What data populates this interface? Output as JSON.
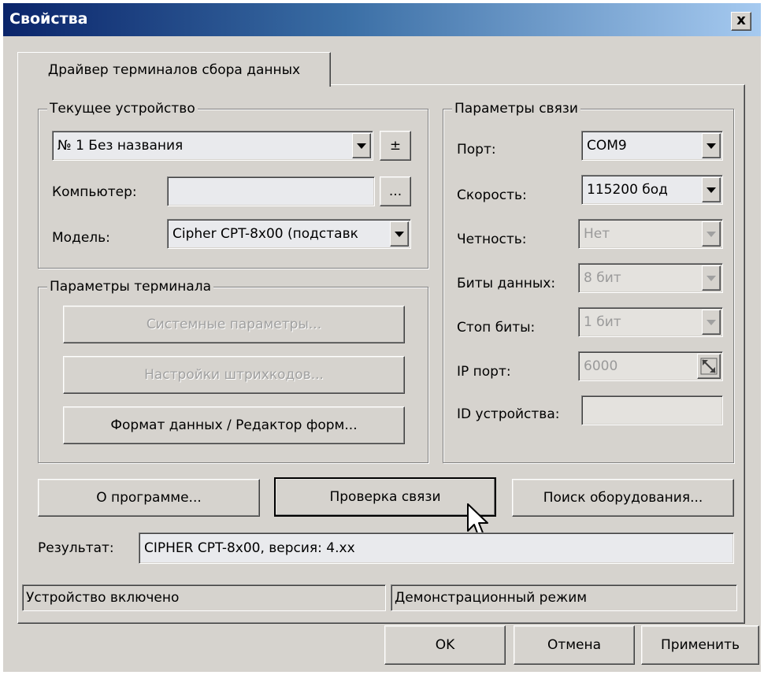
{
  "window": {
    "title": "Свойства",
    "close_label": "x"
  },
  "tab": {
    "label": "Драйвер терминалов сбора данных"
  },
  "current_device": {
    "legend": "Текущее устройство",
    "device_value": "№ 1 Без названия",
    "plusminus_label": "±",
    "computer_label": "Компьютер:",
    "computer_value": "",
    "browse_label": "...",
    "model_label": "Модель:",
    "model_value": "Cipher CPT-8x00 (подставк"
  },
  "terminal_params": {
    "legend": "Параметры терминала",
    "system_params_label": "Системные параметры...",
    "barcode_settings_label": "Настройки штрихкодов...",
    "data_format_label": "Формат данных / Редактор форм..."
  },
  "connection": {
    "legend": "Параметры связи",
    "port_label": "Порт:",
    "port_value": "COM9",
    "speed_label": "Скорость:",
    "speed_value": "115200 бод",
    "parity_label": "Четность:",
    "parity_value": "Нет",
    "databits_label": "Биты данных:",
    "databits_value": "8 бит",
    "stopbits_label": "Стоп биты:",
    "stopbits_value": "1 бит",
    "ipport_label": "IP порт:",
    "ipport_value": "6000",
    "deviceid_label": "ID устройства:",
    "deviceid_value": ""
  },
  "actions": {
    "about_label": "О программе...",
    "check_label": "Проверка связи",
    "search_label": "Поиск оборудования..."
  },
  "result": {
    "label": "Результат:",
    "value": "CIPHER CPT-8x00, версия: 4.xx"
  },
  "status": {
    "left": "Устройство включено",
    "right": "Демонстрационный режим"
  },
  "footer": {
    "ok_label": "OK",
    "cancel_label": "Отмена",
    "apply_label": "Применить"
  }
}
